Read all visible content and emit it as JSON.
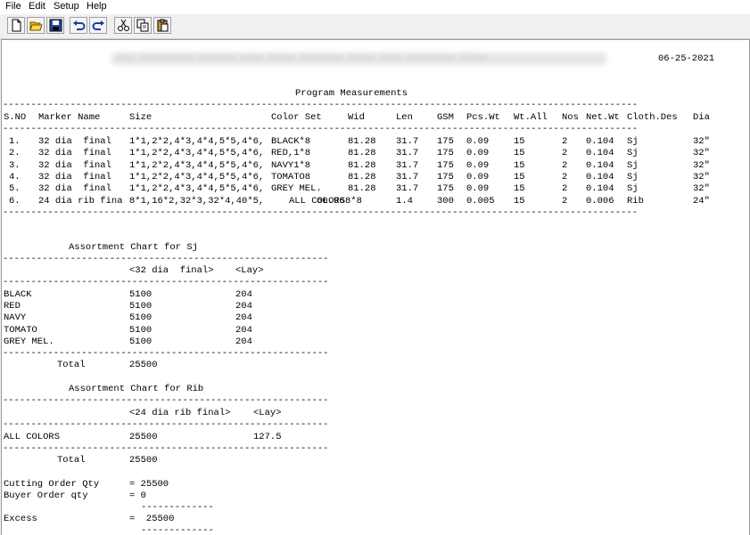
{
  "menu": [
    "File",
    "Edit",
    "Setup",
    "Help"
  ],
  "toolbar": [
    "new-icon",
    "open-icon",
    "save-icon",
    "undo-icon",
    "redo-icon",
    "cut-icon",
    "copy-icon",
    "paste-icon"
  ],
  "report": {
    "header_date": "06-25-2021",
    "title": "Program Measurements",
    "rule_long": "-----------------------------------------------------------------------------------------------------------------",
    "columns": [
      "S.NO",
      "Marker Name",
      "Size",
      "Color Set",
      "Wid",
      "Len",
      "GSM",
      "Pcs.Wt",
      "Wt.All",
      "Nos",
      "Net.Wt",
      "Cloth.Des",
      "Dia"
    ],
    "rows": [
      [
        "1.",
        "32 dia  final",
        "1*1,2*2,4*3,4*4,5*5,4*6,",
        "BLACK*8",
        "81.28",
        "31.7",
        "175",
        "0.09",
        "15",
        "2",
        "0.104",
        "Sj",
        "32\""
      ],
      [
        "2.",
        "32 dia  final",
        "1*1,2*2,4*3,4*4,5*5,4*6,",
        "RED,1*8",
        "81.28",
        "31.7",
        "175",
        "0.09",
        "15",
        "2",
        "0.104",
        "Sj",
        "32\""
      ],
      [
        "3.",
        "32 dia  final",
        "1*1,2*2,4*3,4*4,5*5,4*6,",
        "NAVY1*8",
        "81.28",
        "31.7",
        "175",
        "0.09",
        "15",
        "2",
        "0.104",
        "Sj",
        "32\""
      ],
      [
        "4.",
        "32 dia  final",
        "1*1,2*2,4*3,4*4,5*5,4*6,",
        "TOMATO8",
        "81.28",
        "31.7",
        "175",
        "0.09",
        "15",
        "2",
        "0.104",
        "Sj",
        "32\""
      ],
      [
        "5.",
        "32 dia  final",
        "1*1,2*2,4*3,4*4,5*5,4*6,",
        "GREY MEL.",
        "81.28",
        "31.7",
        "175",
        "0.09",
        "15",
        "2",
        "0.104",
        "Sj",
        "32\""
      ],
      [
        "6.",
        "24 dia rib fina",
        "8*1,16*2,32*3,32*4,40*5,",
        "ALL COLORS8*8",
        "60.96",
        "1.4",
        "300",
        "0.005",
        "15",
        "2",
        "0.006",
        "Rib",
        "24\""
      ]
    ],
    "rule_short": "----------------------------------------------------------",
    "sj": {
      "title": "Assortment Chart for Sj",
      "col_marker": "<32 dia  final>",
      "col_lay": "<Lay>",
      "rows": [
        [
          "BLACK",
          "5100",
          "204"
        ],
        [
          "RED",
          "5100",
          "204"
        ],
        [
          "NAVY",
          "5100",
          "204"
        ],
        [
          "TOMATO",
          "5100",
          "204"
        ],
        [
          "GREY MEL.",
          "5100",
          "204"
        ]
      ],
      "total_label": "Total",
      "total_value": "25500"
    },
    "rib": {
      "title": "Assortment Chart for Rib",
      "col_marker": "<24 dia rib final>",
      "col_lay": "<Lay>",
      "rows": [
        [
          "ALL COLORS",
          "25500",
          "127.5"
        ]
      ],
      "total_label": "Total",
      "total_value": "25500"
    },
    "summary": {
      "cutting_label": "Cutting Order Qty",
      "cutting_value": "= 25500",
      "buyer_label": "Buyer Order qty",
      "buyer_value": "= 0",
      "dash": "-------------",
      "excess_label": "Excess",
      "excess_value": "=  25500"
    }
  }
}
